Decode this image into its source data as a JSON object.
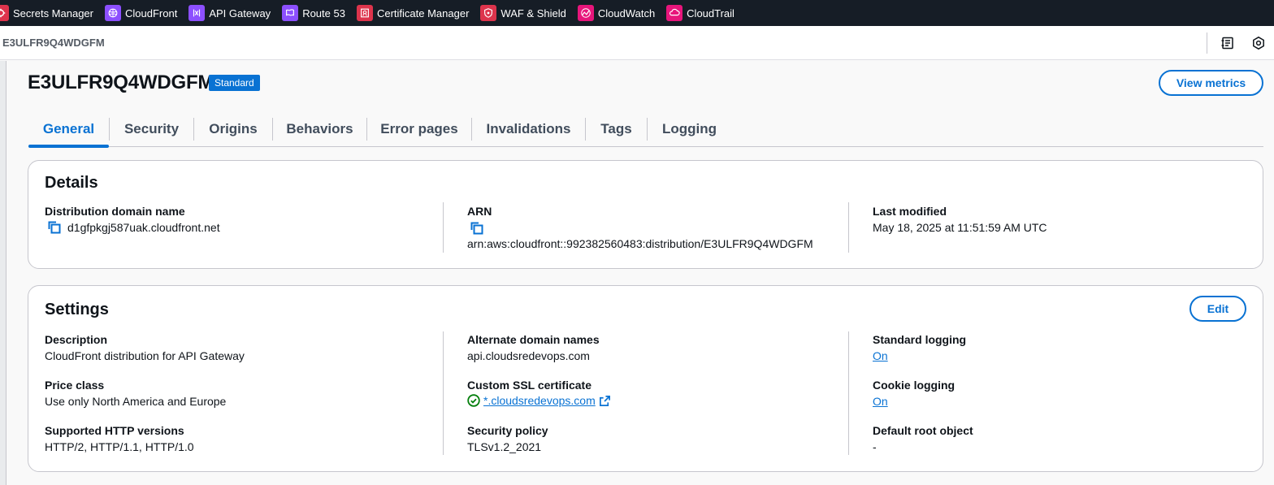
{
  "favorites": [
    {
      "label": "Secrets Manager",
      "icon": "secrets-manager-icon",
      "color": "#dd344c"
    },
    {
      "label": "CloudFront",
      "icon": "cloudfront-icon",
      "color": "#8c4fff"
    },
    {
      "label": "API Gateway",
      "icon": "api-gateway-icon",
      "color": "#8c4fff"
    },
    {
      "label": "Route 53",
      "icon": "route53-icon",
      "color": "#8c4fff"
    },
    {
      "label": "Certificate Manager",
      "icon": "certificate-manager-icon",
      "color": "#dd344c"
    },
    {
      "label": "WAF & Shield",
      "icon": "waf-shield-icon",
      "color": "#dd344c"
    },
    {
      "label": "CloudWatch",
      "icon": "cloudwatch-icon",
      "color": "#e7157b"
    },
    {
      "label": "CloudTrail",
      "icon": "cloudtrail-icon",
      "color": "#e7157b"
    }
  ],
  "breadcrumb": {
    "current": "E3ULFR9Q4WDGFM"
  },
  "header": {
    "title": "E3ULFR9Q4WDGFM",
    "badge": "Standard",
    "view_metrics_label": "View metrics"
  },
  "tabs": [
    {
      "label": "General",
      "active": true
    },
    {
      "label": "Security"
    },
    {
      "label": "Origins"
    },
    {
      "label": "Behaviors"
    },
    {
      "label": "Error pages"
    },
    {
      "label": "Invalidations"
    },
    {
      "label": "Tags"
    },
    {
      "label": "Logging"
    }
  ],
  "details": {
    "title": "Details",
    "domain_label": "Distribution domain name",
    "domain_value": "d1gfpkgj587uak.cloudfront.net",
    "arn_label": "ARN",
    "arn_value": "arn:aws:cloudfront::992382560483:distribution/E3ULFR9Q4WDGFM",
    "modified_label": "Last modified",
    "modified_value": "May 18, 2025 at 11:51:59 AM UTC"
  },
  "settings": {
    "title": "Settings",
    "edit_label": "Edit",
    "description_label": "Description",
    "description_value": "CloudFront distribution for API Gateway",
    "price_label": "Price class",
    "price_value": "Use only North America and Europe",
    "http_label": "Supported HTTP versions",
    "http_value": "HTTP/2, HTTP/1.1, HTTP/1.0",
    "alt_domain_label": "Alternate domain names",
    "alt_domain_value": "api.cloudsredevops.com",
    "ssl_label": "Custom SSL certificate",
    "ssl_value": "*.cloudsredevops.com",
    "policy_label": "Security policy",
    "policy_value": "TLSv1.2_2021",
    "std_logging_label": "Standard logging",
    "std_logging_value": "On",
    "cookie_logging_label": "Cookie logging",
    "cookie_logging_value": "On",
    "root_object_label": "Default root object",
    "root_object_value": "-"
  },
  "colors": {
    "accent": "#0972d3",
    "success": "#037f0c",
    "topbar": "#161d26"
  }
}
